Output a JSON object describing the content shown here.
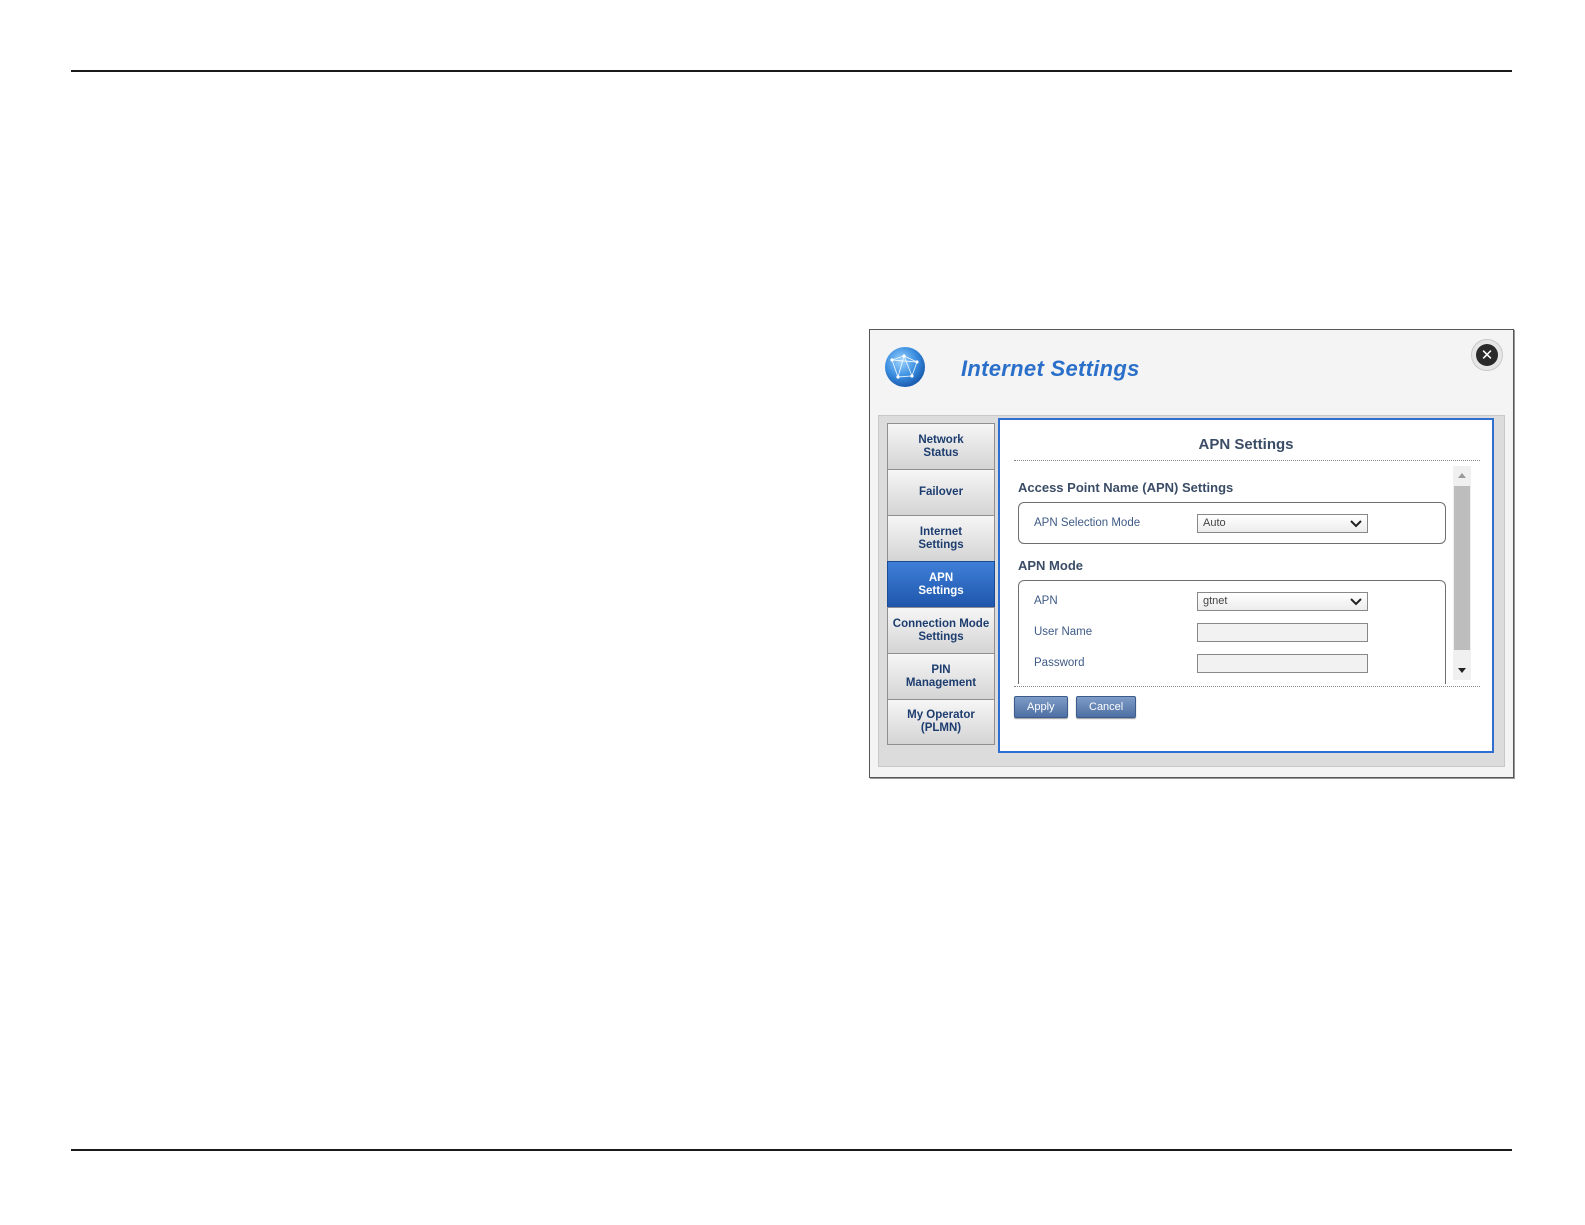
{
  "window": {
    "title": "Internet Settings",
    "close_icon": "close-icon",
    "logo_icon": "globe-icon"
  },
  "sidebar": {
    "items": [
      {
        "label": "Network\nStatus",
        "active": false
      },
      {
        "label": "Failover",
        "active": false
      },
      {
        "label": "Internet\nSettings",
        "active": false
      },
      {
        "label": "APN\nSettings",
        "active": true
      },
      {
        "label": "Connection Mode\nSettings",
        "active": false
      },
      {
        "label": "PIN\nManagement",
        "active": false
      },
      {
        "label": "My Operator\n(PLMN)",
        "active": false
      }
    ]
  },
  "panel": {
    "title": "APN Settings",
    "section1": {
      "heading": "Access Point Name (APN) Settings",
      "apn_selection_mode_label": "APN Selection Mode",
      "apn_selection_mode_value": "Auto"
    },
    "section2": {
      "heading": "APN Mode",
      "apn_label": "APN",
      "apn_value": "gtnet",
      "user_name_label": "User Name",
      "user_name_value": "",
      "password_label": "Password",
      "password_value": ""
    },
    "buttons": {
      "apply": "Apply",
      "cancel": "Cancel"
    }
  },
  "colors": {
    "accent": "#2f6fd1",
    "title": "#2a6fc9",
    "active_tab": "#1f56ac"
  }
}
